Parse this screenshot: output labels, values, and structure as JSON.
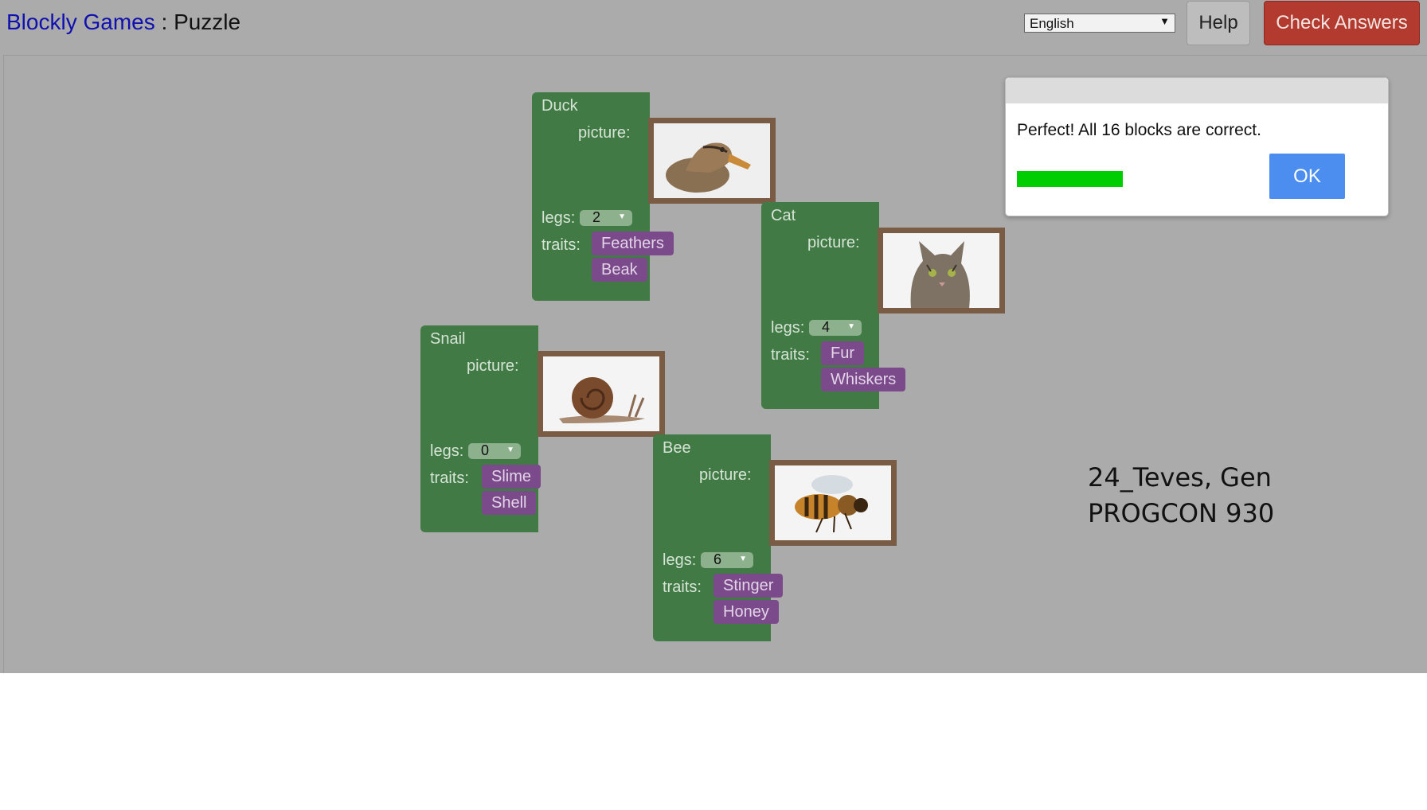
{
  "header": {
    "app_name": "Blockly Games",
    "separator": " : ",
    "page_name": "Puzzle",
    "language": "English",
    "help_label": "Help",
    "check_label": "Check Answers"
  },
  "labels": {
    "picture": "picture:",
    "legs": "legs:",
    "traits": "traits:"
  },
  "animals": [
    {
      "name": "Duck",
      "legs": "2",
      "traits": [
        "Feathers",
        "Beak"
      ],
      "picture_icon": "duck-photo"
    },
    {
      "name": "Cat",
      "legs": "4",
      "traits": [
        "Fur",
        "Whiskers"
      ],
      "picture_icon": "cat-photo"
    },
    {
      "name": "Snail",
      "legs": "0",
      "traits": [
        "Slime",
        "Shell"
      ],
      "picture_icon": "snail-photo"
    },
    {
      "name": "Bee",
      "legs": "6",
      "traits": [
        "Stinger",
        "Honey"
      ],
      "picture_icon": "bee-photo"
    }
  ],
  "dialog": {
    "message": "Perfect! All 16 blocks are correct.",
    "ok_label": "OK",
    "progress": 1.0
  },
  "note": {
    "line1": "24_Teves, Gen",
    "line2": "PROGCON 930"
  },
  "colors": {
    "block_green": "#417a45",
    "trait_purple": "#7a4a8a",
    "check_red": "#b23a2e",
    "ok_blue": "#4c8ef0",
    "progress_green": "#00ce00"
  }
}
